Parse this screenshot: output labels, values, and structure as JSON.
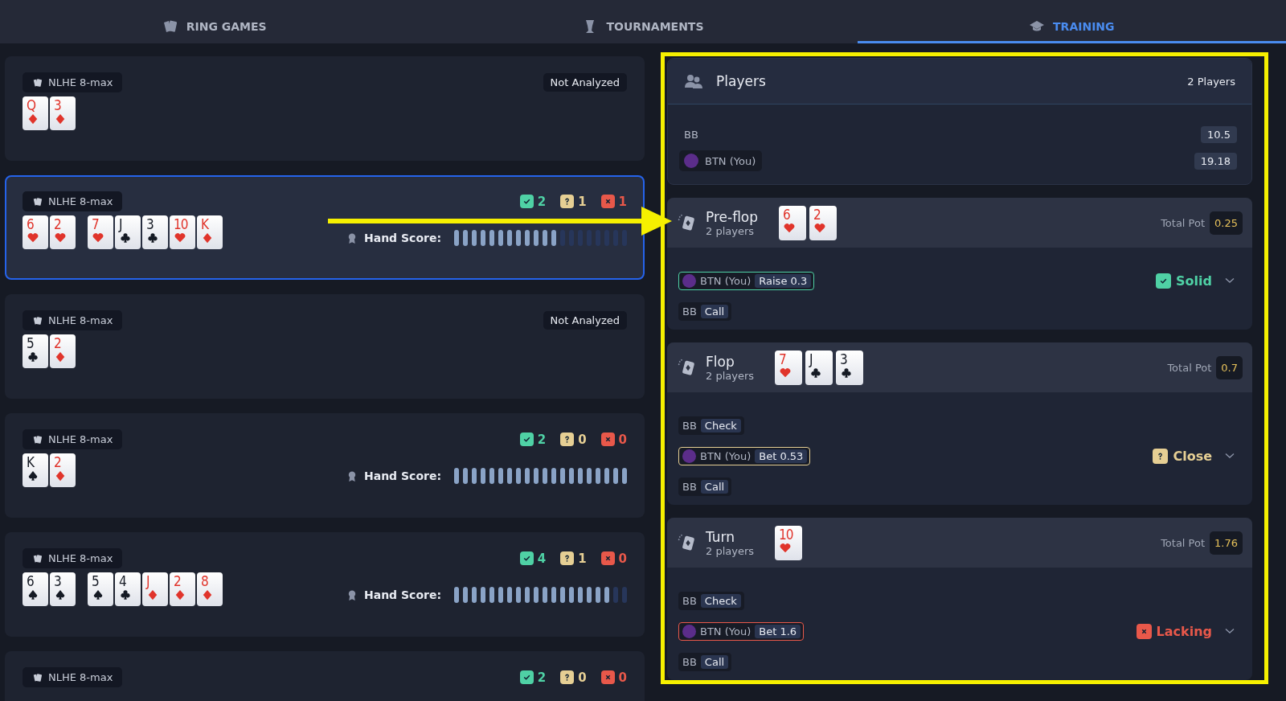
{
  "tabs": [
    {
      "label": "RING GAMES",
      "selected": false
    },
    {
      "label": "TOURNAMENTS",
      "selected": false
    },
    {
      "label": "TRAINING",
      "selected": true
    }
  ],
  "hands": [
    {
      "game": "NLHE 8-max",
      "selected": false,
      "status": "Not Analyzed",
      "hole": [
        {
          "rank": "Q",
          "kind": "diamonds"
        },
        {
          "rank": "3",
          "kind": "diamonds"
        }
      ]
    },
    {
      "game": "NLHE 8-max",
      "selected": true,
      "counts": [
        {
          "kind": "good",
          "value": "2"
        },
        {
          "kind": "unsure",
          "value": "1"
        },
        {
          "kind": "bad",
          "value": "1"
        }
      ],
      "hole": [
        {
          "rank": "6",
          "kind": "hearts"
        },
        {
          "rank": "2",
          "kind": "hearts"
        }
      ],
      "board": [
        {
          "rank": "7",
          "kind": "hearts"
        },
        {
          "rank": "J",
          "kind": "clubs"
        },
        {
          "rank": "3",
          "kind": "clubs"
        },
        {
          "rank": "10",
          "kind": "hearts"
        },
        {
          "rank": "K",
          "kind": "diamonds"
        }
      ],
      "score_label": "Hand Score:",
      "level": 0.6
    },
    {
      "game": "NLHE 8-max",
      "selected": false,
      "status": "Not Analyzed",
      "hole": [
        {
          "rank": "5",
          "kind": "clubs"
        },
        {
          "rank": "2",
          "kind": "diamonds"
        }
      ]
    },
    {
      "game": "NLHE 8-max",
      "selected": false,
      "counts": [
        {
          "kind": "good",
          "value": "2"
        },
        {
          "kind": "unsure",
          "value": "0"
        },
        {
          "kind": "bad",
          "value": "0"
        }
      ],
      "hole": [
        {
          "rank": "K",
          "kind": "spades"
        },
        {
          "rank": "2",
          "kind": "diamonds"
        }
      ],
      "score_label": "Hand Score:",
      "level": 1
    },
    {
      "game": "NLHE 8-max",
      "selected": false,
      "counts": [
        {
          "kind": "good",
          "value": "4"
        },
        {
          "kind": "unsure",
          "value": "1"
        },
        {
          "kind": "bad",
          "value": "0"
        }
      ],
      "hole": [
        {
          "rank": "6",
          "kind": "spades"
        },
        {
          "rank": "3",
          "kind": "spades"
        }
      ],
      "board": [
        {
          "rank": "5",
          "kind": "spades"
        },
        {
          "rank": "4",
          "kind": "clubs"
        },
        {
          "rank": "J",
          "kind": "diamonds"
        },
        {
          "rank": "2",
          "kind": "diamonds"
        },
        {
          "rank": "8",
          "kind": "diamonds"
        }
      ],
      "score_label": "Hand Score:",
      "level": 0.9
    },
    {
      "game": "NLHE 8-max",
      "selected": false,
      "counts": [
        {
          "kind": "good",
          "value": "2"
        },
        {
          "kind": "unsure",
          "value": "0"
        },
        {
          "kind": "bad",
          "value": "0"
        }
      ]
    }
  ],
  "players": {
    "title": "Players",
    "count": "2 Players",
    "rows": [
      {
        "position": "BB",
        "avatar": false,
        "stack": "10.5"
      },
      {
        "position": "BTN (You)",
        "avatar": true,
        "stack": "19.18"
      }
    ]
  },
  "streets": [
    {
      "name": "Pre-flop",
      "players": "2 players",
      "cards": [
        {
          "rank": "6",
          "kind": "hearts"
        },
        {
          "rank": "2",
          "kind": "hearts"
        }
      ],
      "pot_label": "Total Pot",
      "pot": "0.25",
      "rating": {
        "kind": "good",
        "label": "Solid"
      },
      "actions": [
        {
          "position": "BTN (You)",
          "avatar": true,
          "action": "Raise 0.3",
          "rated": true
        },
        {
          "position": "BB",
          "avatar": false,
          "action": "Call",
          "rated": false
        }
      ]
    },
    {
      "name": "Flop",
      "players": "2 players",
      "cards": [
        {
          "rank": "7",
          "kind": "hearts"
        },
        {
          "rank": "J",
          "kind": "clubs"
        },
        {
          "rank": "3",
          "kind": "clubs"
        }
      ],
      "pot_label": "Total Pot",
      "pot": "0.7",
      "rating": {
        "kind": "unsure",
        "label": "Close"
      },
      "actions": [
        {
          "position": "BB",
          "avatar": false,
          "action": "Check",
          "rated": false
        },
        {
          "position": "BTN (You)",
          "avatar": true,
          "action": "Bet 0.53",
          "rated": true
        },
        {
          "position": "BB",
          "avatar": false,
          "action": "Call",
          "rated": false
        }
      ]
    },
    {
      "name": "Turn",
      "players": "2 players",
      "cards": [
        {
          "rank": "10",
          "kind": "hearts"
        }
      ],
      "pot_label": "Total Pot",
      "pot": "1.76",
      "rating": {
        "kind": "bad",
        "label": "Lacking"
      },
      "actions": [
        {
          "position": "BB",
          "avatar": false,
          "action": "Check",
          "rated": false
        },
        {
          "position": "BTN (You)",
          "avatar": true,
          "action": "Bet 1.6",
          "rated": true
        },
        {
          "position": "BB",
          "avatar": false,
          "action": "Call",
          "rated": false
        }
      ]
    }
  ]
}
